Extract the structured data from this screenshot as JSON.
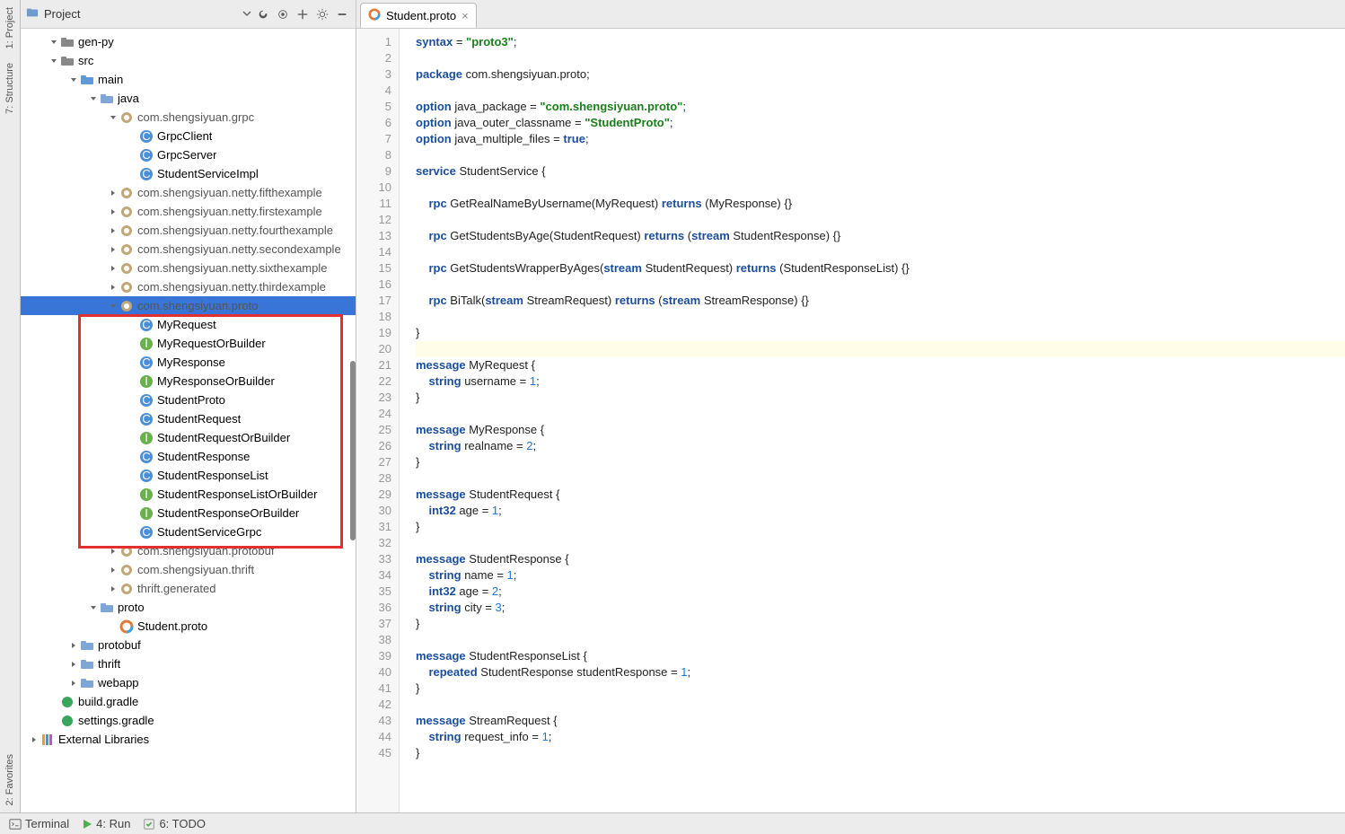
{
  "left_sidebar": {
    "project_tab": "1: Project",
    "structure_tab": "7: Structure",
    "favorites_tab": "2: Favorites"
  },
  "project_panel": {
    "header_title": "Project",
    "tree": [
      {
        "indent": 1,
        "arrow": "down",
        "icon": "folder",
        "label": "gen-py",
        "name": "folder-gen-py"
      },
      {
        "indent": 1,
        "arrow": "down",
        "icon": "folder",
        "label": "src",
        "name": "folder-src"
      },
      {
        "indent": 2,
        "arrow": "down",
        "icon": "folder-src",
        "label": "main",
        "name": "folder-main"
      },
      {
        "indent": 3,
        "arrow": "down",
        "icon": "folder-blue",
        "label": "java",
        "name": "folder-java"
      },
      {
        "indent": 4,
        "arrow": "down",
        "icon": "package",
        "label": "com.shengsiyuan.grpc",
        "name": "package-grpc"
      },
      {
        "indent": 5,
        "arrow": "",
        "icon": "class-c",
        "label": "GrpcClient",
        "name": "class-grpcclient"
      },
      {
        "indent": 5,
        "arrow": "",
        "icon": "class-c",
        "label": "GrpcServer",
        "name": "class-grpcserver"
      },
      {
        "indent": 5,
        "arrow": "",
        "icon": "class-c",
        "label": "StudentServiceImpl",
        "name": "class-studentserviceimpl"
      },
      {
        "indent": 4,
        "arrow": "right",
        "icon": "package",
        "label": "com.shengsiyuan.netty.fifthexample",
        "name": "package-fifth"
      },
      {
        "indent": 4,
        "arrow": "right",
        "icon": "package",
        "label": "com.shengsiyuan.netty.firstexample",
        "name": "package-first"
      },
      {
        "indent": 4,
        "arrow": "right",
        "icon": "package",
        "label": "com.shengsiyuan.netty.fourthexample",
        "name": "package-fourth"
      },
      {
        "indent": 4,
        "arrow": "right",
        "icon": "package",
        "label": "com.shengsiyuan.netty.secondexample",
        "name": "package-second"
      },
      {
        "indent": 4,
        "arrow": "right",
        "icon": "package",
        "label": "com.shengsiyuan.netty.sixthexample",
        "name": "package-sixth"
      },
      {
        "indent": 4,
        "arrow": "right",
        "icon": "package",
        "label": "com.shengsiyuan.netty.thirdexample",
        "name": "package-third"
      },
      {
        "indent": 4,
        "arrow": "down",
        "icon": "package",
        "label": "com.shengsiyuan.proto",
        "name": "package-proto",
        "selected": true
      },
      {
        "indent": 5,
        "arrow": "",
        "icon": "class-c",
        "label": "MyRequest",
        "name": "class-myrequest"
      },
      {
        "indent": 5,
        "arrow": "",
        "icon": "interface",
        "label": "MyRequestOrBuilder",
        "name": "iface-myrequestorbuilder"
      },
      {
        "indent": 5,
        "arrow": "",
        "icon": "class-c",
        "label": "MyResponse",
        "name": "class-myresponse"
      },
      {
        "indent": 5,
        "arrow": "",
        "icon": "interface",
        "label": "MyResponseOrBuilder",
        "name": "iface-myresponseorbuilder"
      },
      {
        "indent": 5,
        "arrow": "",
        "icon": "class-c",
        "label": "StudentProto",
        "name": "class-studentproto"
      },
      {
        "indent": 5,
        "arrow": "",
        "icon": "class-c",
        "label": "StudentRequest",
        "name": "class-studentrequest"
      },
      {
        "indent": 5,
        "arrow": "",
        "icon": "interface",
        "label": "StudentRequestOrBuilder",
        "name": "iface-studentrequestorbuilder"
      },
      {
        "indent": 5,
        "arrow": "",
        "icon": "class-c",
        "label": "StudentResponse",
        "name": "class-studentresponse"
      },
      {
        "indent": 5,
        "arrow": "",
        "icon": "class-c",
        "label": "StudentResponseList",
        "name": "class-studentresponselist"
      },
      {
        "indent": 5,
        "arrow": "",
        "icon": "interface",
        "label": "StudentResponseListOrBuilder",
        "name": "iface-studentresponselistorbuilder"
      },
      {
        "indent": 5,
        "arrow": "",
        "icon": "interface",
        "label": "StudentResponseOrBuilder",
        "name": "iface-studentresponseorbuilder"
      },
      {
        "indent": 5,
        "arrow": "",
        "icon": "class-c",
        "label": "StudentServiceGrpc",
        "name": "class-studentservicegrpc"
      },
      {
        "indent": 4,
        "arrow": "right",
        "icon": "package",
        "label": "com.shengsiyuan.protobuf",
        "name": "package-protobuf"
      },
      {
        "indent": 4,
        "arrow": "right",
        "icon": "package",
        "label": "com.shengsiyuan.thrift",
        "name": "package-thrift"
      },
      {
        "indent": 4,
        "arrow": "right",
        "icon": "package",
        "label": "thrift.generated",
        "name": "package-thriftgen"
      },
      {
        "indent": 3,
        "arrow": "down",
        "icon": "folder-blue",
        "label": "proto",
        "name": "folder-proto"
      },
      {
        "indent": 4,
        "arrow": "",
        "icon": "proto",
        "label": "Student.proto",
        "name": "file-student-proto"
      },
      {
        "indent": 2,
        "arrow": "right",
        "icon": "folder-blue",
        "label": "protobuf",
        "name": "folder-protobuf"
      },
      {
        "indent": 2,
        "arrow": "right",
        "icon": "folder-blue",
        "label": "thrift",
        "name": "folder-thrift"
      },
      {
        "indent": 2,
        "arrow": "right",
        "icon": "folder-blue",
        "label": "webapp",
        "name": "folder-webapp"
      },
      {
        "indent": 1,
        "arrow": "",
        "icon": "gradle",
        "label": "build.gradle",
        "name": "file-build-gradle"
      },
      {
        "indent": 1,
        "arrow": "",
        "icon": "gradle",
        "label": "settings.gradle",
        "name": "file-settings-gradle"
      },
      {
        "indent": 0,
        "arrow": "right",
        "icon": "libraries",
        "label": "External Libraries",
        "name": "external-libraries"
      }
    ]
  },
  "editor": {
    "tab_name": "Student.proto",
    "lines": [
      {
        "n": 1,
        "html": "<span class='kw'>syntax</span> = <span class='str'>\"proto3\"</span>;"
      },
      {
        "n": 2,
        "html": ""
      },
      {
        "n": 3,
        "html": "<span class='kw'>package</span> com.shengsiyuan.proto;"
      },
      {
        "n": 4,
        "html": ""
      },
      {
        "n": 5,
        "html": "<span class='kw'>option</span> java_package = <span class='str'>\"com.shengsiyuan.proto\"</span>;"
      },
      {
        "n": 6,
        "html": "<span class='kw'>option</span> java_outer_classname = <span class='str'>\"StudentProto\"</span>;"
      },
      {
        "n": 7,
        "html": "<span class='kw'>option</span> java_multiple_files = <span class='kw'>true</span>;"
      },
      {
        "n": 8,
        "html": ""
      },
      {
        "n": 9,
        "html": "<span class='kw'>service</span> StudentService {"
      },
      {
        "n": 10,
        "html": ""
      },
      {
        "n": 11,
        "html": "    <span class='kw'>rpc</span> GetRealNameByUsername(MyRequest) <span class='ret'>returns</span> (MyResponse) {}"
      },
      {
        "n": 12,
        "html": ""
      },
      {
        "n": 13,
        "html": "    <span class='kw'>rpc</span> GetStudentsByAge(StudentRequest) <span class='ret'>returns</span> (<span class='kw'>stream</span> StudentResponse) {}"
      },
      {
        "n": 14,
        "html": ""
      },
      {
        "n": 15,
        "html": "    <span class='kw'>rpc</span> GetStudentsWrapperByAges(<span class='kw'>stream</span> StudentRequest) <span class='ret'>returns</span> (StudentResponseList) {}"
      },
      {
        "n": 16,
        "html": ""
      },
      {
        "n": 17,
        "html": "    <span class='kw'>rpc</span> BiTalk(<span class='kw'>stream</span> StreamRequest) <span class='ret'>returns</span> (<span class='kw'>stream</span> StreamResponse) {}"
      },
      {
        "n": 18,
        "html": ""
      },
      {
        "n": 19,
        "html": "}"
      },
      {
        "n": 20,
        "html": "",
        "highlight": true
      },
      {
        "n": 21,
        "html": "<span class='kw'>message</span> MyRequest {"
      },
      {
        "n": 22,
        "html": "    <span class='kw'>string</span> username = <span class='num'>1</span>;"
      },
      {
        "n": 23,
        "html": "}"
      },
      {
        "n": 24,
        "html": ""
      },
      {
        "n": 25,
        "html": "<span class='kw'>message</span> MyResponse {"
      },
      {
        "n": 26,
        "html": "    <span class='kw'>string</span> realname = <span class='num'>2</span>;"
      },
      {
        "n": 27,
        "html": "}"
      },
      {
        "n": 28,
        "html": ""
      },
      {
        "n": 29,
        "html": "<span class='kw'>message</span> StudentRequest {"
      },
      {
        "n": 30,
        "html": "    <span class='kw'>int32</span> age = <span class='num'>1</span>;"
      },
      {
        "n": 31,
        "html": "}"
      },
      {
        "n": 32,
        "html": ""
      },
      {
        "n": 33,
        "html": "<span class='kw'>message</span> StudentResponse {"
      },
      {
        "n": 34,
        "html": "    <span class='kw'>string</span> name = <span class='num'>1</span>;"
      },
      {
        "n": 35,
        "html": "    <span class='kw'>int32</span> age = <span class='num'>2</span>;"
      },
      {
        "n": 36,
        "html": "    <span class='kw'>string</span> city = <span class='num'>3</span>;"
      },
      {
        "n": 37,
        "html": "}"
      },
      {
        "n": 38,
        "html": ""
      },
      {
        "n": 39,
        "html": "<span class='kw'>message</span> StudentResponseList {"
      },
      {
        "n": 40,
        "html": "    <span class='kw'>repeated</span> StudentResponse studentResponse = <span class='num'>1</span>;"
      },
      {
        "n": 41,
        "html": "}"
      },
      {
        "n": 42,
        "html": ""
      },
      {
        "n": 43,
        "html": "<span class='kw'>message</span> StreamRequest {"
      },
      {
        "n": 44,
        "html": "    <span class='kw'>string</span> request_info = <span class='num'>1</span>;"
      },
      {
        "n": 45,
        "html": "}"
      }
    ]
  },
  "status_bar": {
    "terminal": "Terminal",
    "run": "4: Run",
    "todo": "6: TODO"
  }
}
